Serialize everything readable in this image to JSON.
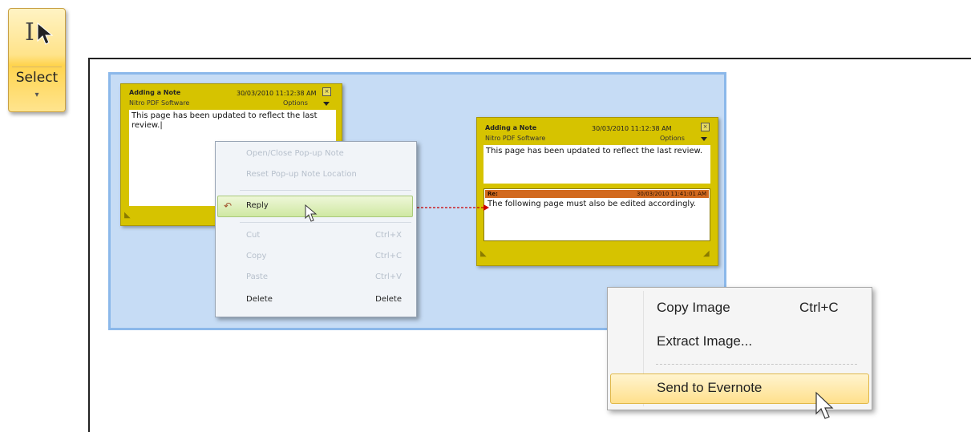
{
  "toolbar": {
    "select_label": "Select",
    "dropdown_glyph": "▾",
    "ibeam_glyph": "I"
  },
  "note1": {
    "title": "Adding a Note",
    "date": "30/03/2010 11:12:38 AM",
    "author": "Nitro PDF Software",
    "options": "Options",
    "close": "×",
    "body": "This page has been updated to reflect the last review."
  },
  "note2": {
    "title": "Adding a Note",
    "date": "30/03/2010 11:12:38 AM",
    "author": "Nitro PDF Software",
    "options": "Options",
    "close": "×",
    "body": "This page has been updated to reflect the last review.",
    "reply_header": "Re:",
    "reply_date": "30/03/2010 11:41:01 AM",
    "reply_body": "The following page must also be edited accordingly."
  },
  "context_menu": {
    "open_close": "Open/Close Pop-up Note",
    "reset": "Reset Pop-up Note Location",
    "reply": "Reply",
    "cut": "Cut",
    "cut_shortcut": "Ctrl+X",
    "copy": "Copy",
    "copy_shortcut": "Ctrl+C",
    "paste": "Paste",
    "paste_shortcut": "Ctrl+V",
    "delete": "Delete",
    "delete_shortcut": "Delete"
  },
  "image_menu": {
    "copy_image": "Copy Image",
    "copy_image_shortcut": "Ctrl+C",
    "extract_image": "Extract Image...",
    "send_to_evernote": "Send to Evernote"
  },
  "colors": {
    "note_yellow": "#d6c300",
    "selection_blue": "#c6dcf5",
    "reply_bar": "#d2691e",
    "arrow_red": "#cc0000"
  }
}
